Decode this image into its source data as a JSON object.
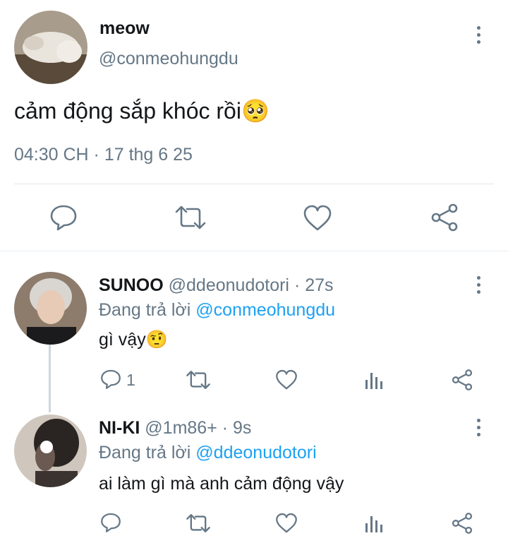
{
  "main_tweet": {
    "display_name": "meow",
    "handle": "@conmeohungdu",
    "text": "cảm động sắp khóc rồi",
    "emoji": "🥺",
    "timestamp": "04:30 CH · 17 thg 6 25",
    "actions": [
      "reply-icon",
      "retweet-icon",
      "like-icon",
      "share-icon"
    ]
  },
  "replies": [
    {
      "display_name": "SUNOO",
      "handle": "@ddeonudotori",
      "time": "· 27s",
      "replying_prefix": "Đang trả lời",
      "replying_to": "@conmeohungdu",
      "text": "gì vậy",
      "emoji": "🤨",
      "reply_count": "1"
    },
    {
      "display_name": "NI-KI",
      "handle": "@1m86+",
      "time": "· 9s",
      "replying_prefix": "Đang trả lời",
      "replying_to": "@ddeonudotori",
      "text": "ai làm gì mà anh cảm động vậy",
      "emoji": "",
      "reply_count": ""
    }
  ],
  "colors": {
    "text": "#14171a",
    "secondary": "#657786",
    "link": "#1da1f2",
    "divider": "#e1e8ed"
  }
}
